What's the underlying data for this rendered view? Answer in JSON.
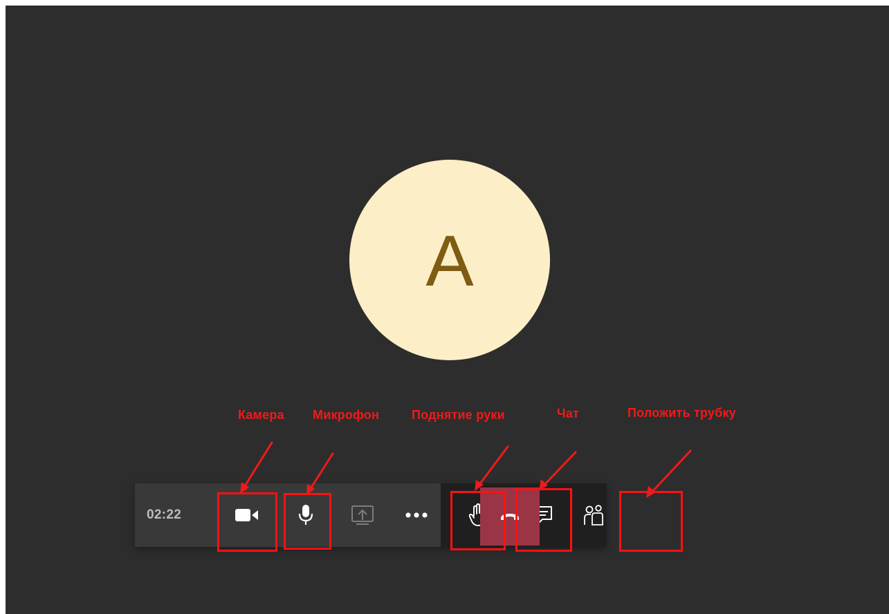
{
  "call": {
    "avatar_initial": "A",
    "timer": "02:22"
  },
  "toolbar": {
    "buttons": [
      {
        "id": "camera",
        "icon": "video-camera-icon"
      },
      {
        "id": "microphone",
        "icon": "microphone-icon"
      },
      {
        "id": "share",
        "icon": "share-screen-icon"
      },
      {
        "id": "more",
        "icon": "more-dots-icon"
      },
      {
        "id": "raise_hand",
        "icon": "raise-hand-icon"
      },
      {
        "id": "chat",
        "icon": "chat-icon"
      },
      {
        "id": "participants",
        "icon": "participants-icon"
      },
      {
        "id": "hang_up",
        "icon": "hang-up-phone-icon"
      }
    ]
  },
  "annotations": {
    "camera": "Камера",
    "microphone": "Микрофон",
    "raise_hand": "Поднятие руки",
    "chat": "Чат",
    "hang_up": "Положить трубку"
  },
  "colors": {
    "stage_background": "#2e2d2d",
    "avatar_background": "#fcefc8",
    "avatar_initial": "#7e5c12",
    "toolbar_dark": "#1f1f1f",
    "toolbar_light": "#3a3939",
    "hang_up": "#9a3545",
    "annotation_red": "#ee1b1b"
  }
}
